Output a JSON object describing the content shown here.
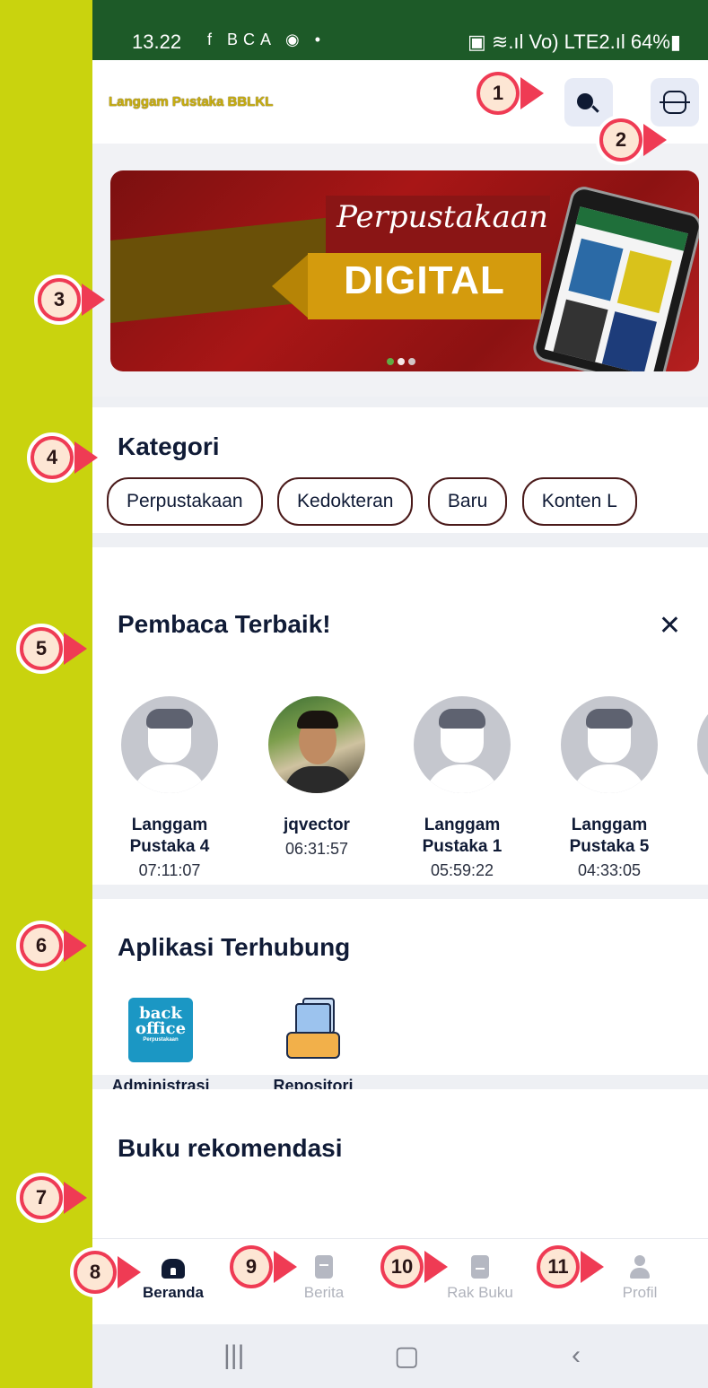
{
  "status_bar": {
    "time": "13.22",
    "icons": "f BCA ◉ •",
    "right": "▣ ≋.ıl Vo) LTE2.ıl 64%▮"
  },
  "app_bar": {
    "title": "Langgam Pustaka BBLKL"
  },
  "banner": {
    "script_text": "Perpustakaan",
    "main_text": "DIGITAL"
  },
  "kategori": {
    "title": "Kategori",
    "chips": [
      "Perpustakaan",
      "Kedokteran",
      "Baru",
      "Konten L"
    ]
  },
  "pembaca": {
    "title": "Pembaca Terbaik!",
    "close": "✕",
    "readers": [
      {
        "name": "Langgam Pustaka 4",
        "time": "07:11:07"
      },
      {
        "name": "jqvector",
        "time": "06:31:57"
      },
      {
        "name": "Langgam Pustaka 1",
        "time": "05:59:22"
      },
      {
        "name": "Langgam Pustaka 5",
        "time": "04:33:05"
      }
    ]
  },
  "aplikasi": {
    "title": "Aplikasi Terhubung",
    "apps": [
      {
        "label": "Administrasi",
        "icon_text": "back office",
        "icon_sub": "Perpustakaan"
      },
      {
        "label": "Repositori"
      }
    ]
  },
  "rekomendasi": {
    "title": "Buku rekomendasi"
  },
  "bottom_nav": {
    "items": [
      {
        "label": "Beranda",
        "icon": "home-icon"
      },
      {
        "label": "Berita",
        "icon": "news-icon"
      },
      {
        "label": "Rak Buku",
        "icon": "bookshelf-icon"
      },
      {
        "label": "Profil",
        "icon": "profile-icon"
      }
    ]
  },
  "system_nav": {
    "recents": "|||",
    "home": "▢",
    "back": "‹"
  },
  "annotations": [
    "1",
    "2",
    "3",
    "4",
    "5",
    "6",
    "7",
    "8",
    "9",
    "10",
    "11"
  ],
  "colors": {
    "background": "#c9d30e",
    "badge": "#ef3b54",
    "status_bar": "#1d5a28",
    "text": "#101b36"
  }
}
